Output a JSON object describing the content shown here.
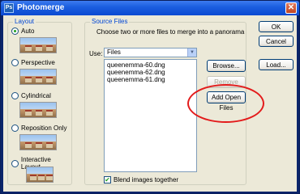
{
  "window": {
    "title": "Photomerge",
    "close_symbol": "✕"
  },
  "layout": {
    "label": "Layout",
    "options": [
      {
        "label": "Auto",
        "selected": true
      },
      {
        "label": "Perspective",
        "selected": false
      },
      {
        "label": "Cylindrical",
        "selected": false
      },
      {
        "label": "Reposition Only",
        "selected": false
      },
      {
        "label": "Interactive Layout",
        "selected": false
      }
    ]
  },
  "source_files": {
    "label": "Source Files",
    "instruction": "Choose two or more files to merge into a panorama",
    "use_label": "Use:",
    "use_value": "Files",
    "files": [
      "queenemma-60.dng",
      "queenemma-62.dng",
      "queenemma-61.dng"
    ],
    "browse_button": "Browse...",
    "remove_button": "Remove",
    "add_open_button": "Add Open Files",
    "blend_label": "Blend images together",
    "blend_checked": true
  },
  "buttons": {
    "ok": "OK",
    "cancel": "Cancel",
    "load": "Load..."
  },
  "colors": {
    "annotation": "#e31b1b",
    "title_bar": "#0a49d1"
  }
}
